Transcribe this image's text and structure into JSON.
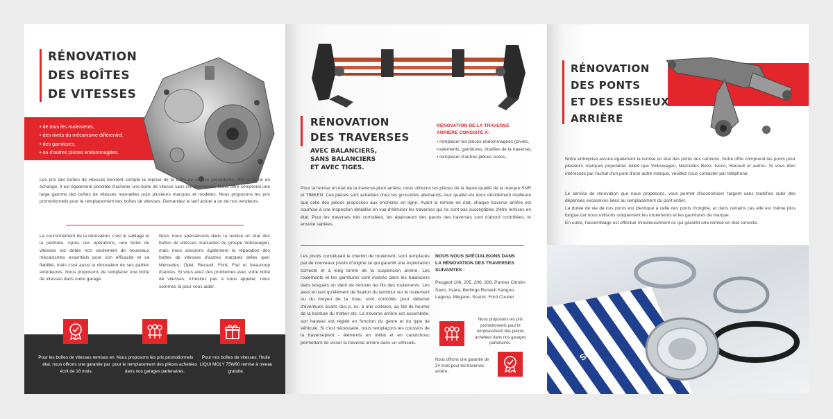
{
  "panel1": {
    "title": [
      "RÉNOVATION",
      "DES BOÎTES",
      "DE VITESSES"
    ],
    "bullets": [
      "de tous les roulements,",
      "des rivets du mécanisme différentiel,",
      "des garnitures,",
      "ou d'autres pièces endommagées."
    ],
    "intro": "Les prix des boîtes de vitesses tiennent compte la reprise de la boîte de vitesse précédente, dite la vente en échange. Il est également possible d'acheter une boîte de vitesse sans remplacement. Notre offre comprend une large gamme des boîtes de vitesses manuelles pour plusieurs marques et modeles. Nous proposons les prix promotionnels pour le remplacement des boîtes de vitesses. Demandez le tarif actuel a un de nos vendeurs.",
    "col_left": "Le couronnement de la rénovation, c'est le sablage et la peinture. Après ces opérations, une boîte de vitesses est dotée non seulement de nouveaux mécanismes essentiels pour son efficacité et sa fiabilité, mais c'est aussi la rénovation de ses parties extérieures. Nous proposons de remplacer une boîte de vitesses dans notre garage.",
    "col_right": "Nous nous spécialisons dans la remise en état des boîtes de vitesses manuelles du groupe Volkswagen, mais nous assurons également la réparation des boîtes de vitesses d'autres marques telles que: Mercedes, Opel, Renault, Ford, Fiat et beaucoup d'autres. Si vous avez des problèmes avec votre boîte de vitesses, n'hésitez pas à nous appeler, nous sommes là pour vous aider.",
    "icons": [
      {
        "icon": "certificate-badge-icon",
        "caption": "Pour les boîtes de vitesses remises en état, nous offrons une garantie par écrit de 18 mois."
      },
      {
        "icon": "auto-parts-icon",
        "caption": "Nous proposons les prix promotionnels pour le remplacement des pièces achetées dans nos garages partenaires."
      },
      {
        "icon": "gift-box-icon",
        "caption": "Pour nos boîtes de vitesses, l'huile LIQUI MOLY 75W90 remise à niveau gratuite."
      }
    ]
  },
  "panel2": {
    "title": [
      "RÉNOVATION",
      "DES TRAVERSES"
    ],
    "subtitle": [
      "AVEC BALANCIERS,",
      "SANS BALANCIERS",
      "ET AVEC TIGES."
    ],
    "red_head": [
      "RÉNOVATION DE LA TRAVERSE",
      "ARRIÈRE CONSISTE À:"
    ],
    "list": [
      "remplacer les pièces endommagées (pivots, roulements, garnitures, douilles de la traverse),",
      "remplacer d'autres pièces usées."
    ],
    "intro": "Pour la remise en état de la traverse-pivot arrière, nous utilisons les pièces de la haute qualité de la marque SNR et TIMKEN. Ces pièces sont achetées chez les grossistes allemands, leur qualité est donc décidément meilleure que celle des pièces proposées aux enchères en ligne. Avant la remise en état, chaque traverse arrière est soumise à une inspection détaillée en vue d'éliminer les traverses qui ne sont pas susceptibles d'être remises en état. Pour les traverses très corrodées, les épaisseurs des parois des traverses sont d'abord contrôlées, et ensuite sablées.",
    "col_left": "Les pivots constituant le chemin de roulement, sont remplacés par de nouveaux pivots d'origine ce qui garantit une exploitation correcte et à long terme de la suspension arrière. Les roulements et les garnitures sont insérés dans les balanciers dans lesquels on vient de rénover les lits des roulements. Les axes en tant qu'élément de fixation du tambour sur le roulement ou du moyeu de la roue, sont contrôlés pour détecter d'éventuels écarts dus p. ex. à une collision, au fait de heurter de la bordure du trottoir etc. La traverse arrière est assemblée, son hauteur est réglée en fonction du genre et du type de véhicule. Si c'est nécessaire, nous remplaçons les coussins de la traversepivot - éléments en métal et en caoutchouc permettant de visser la traverse arrière dans un véhicule.",
    "spec_head": [
      "NOUS NOUS SPÉCIALISONS DANS",
      "LA RÉNOVATION DES TRAVERSES",
      "SUIVANTES :"
    ],
    "spec_models": "Peugeot 106, 205, 206, 306, Partner Citroën Saxo, Xsara, Berlingo Renault Kangoo, Laguna, Megane, Scenic, Ford Courier",
    "promo_caption": "Nous proposons les prix promotionnels pour le remplacement des pièces achetées dans nos garages partenaires.",
    "warranty_caption": "Nous offrons une garantie de 24 mois pour les traverses arrière."
  },
  "panel3": {
    "title": [
      "RÉNOVATION",
      "DES PONTS",
      "ET DES ESSIEUX",
      "ARRIÈRE"
    ],
    "para1": "Notre entreprise assure également la remise en état des ponts des camions. Notre offre comprend les ponts pour plusieurs marques populaires telles que Volkswagen, Mercedes Benz, Iveco, Renault et autres. Si vous êtes intéressés par l'achat d'un pont d'une autre marque, veuillez nous contacter par téléphone.",
    "para2": "Le service de rénovation que nous proposons, vous permet d'économiser l'argent sans toutefois subir des dépenses excessives liées au remplacement du pont entier.",
    "para3": "La durée de vie de nos ponts est identique à celle des ponts d'origine, et dans certains cas elle est même plus longue car nous utilisons uniquement les roulements et les garnitures de marque.",
    "para4": "En outre, l'assemblage est effectué minutieusement ce qui garantit une remise en état correcte.",
    "brand_label": "SNR"
  },
  "colors": {
    "accent": "#e3262b",
    "dark": "#2f2f2f"
  }
}
